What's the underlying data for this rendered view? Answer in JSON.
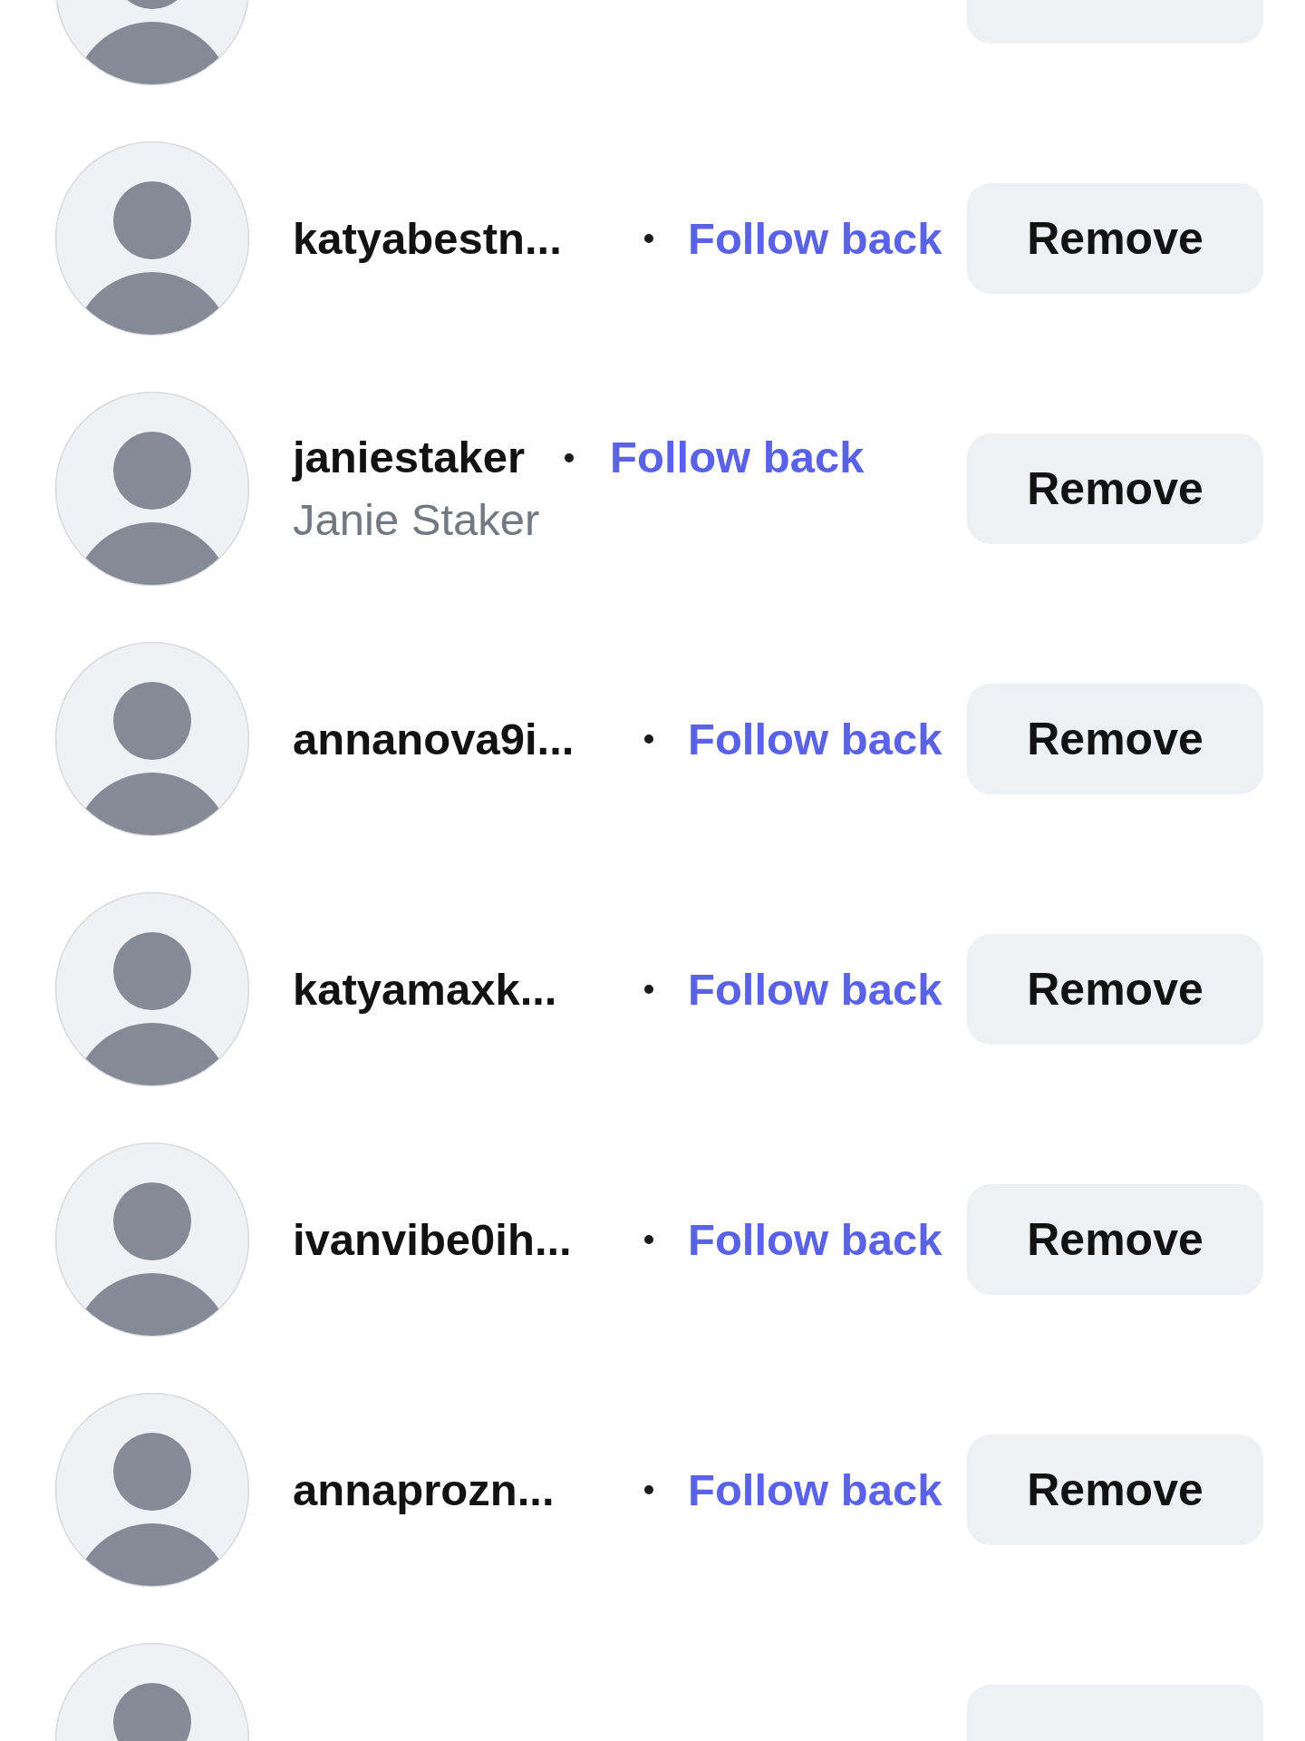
{
  "followers": [
    {
      "kind": "clipped"
    },
    {
      "kind": "row",
      "username": "katyabestn...",
      "follow_label": "Follow back",
      "remove_label": "Remove"
    },
    {
      "kind": "row",
      "username": "janiestaker",
      "full_name": "Janie Staker",
      "follow_label": "Follow back",
      "remove_label": "Remove"
    },
    {
      "kind": "row",
      "username": "annanova9i...",
      "follow_label": "Follow back",
      "remove_label": "Remove"
    },
    {
      "kind": "row",
      "username": "katyamaxk...",
      "follow_label": "Follow back",
      "remove_label": "Remove"
    },
    {
      "kind": "row",
      "username": "ivanvibe0ih...",
      "follow_label": "Follow back",
      "remove_label": "Remove"
    },
    {
      "kind": "row",
      "username": "annaprozn...",
      "follow_label": "Follow back",
      "remove_label": "Remove"
    },
    {
      "kind": "clipped"
    }
  ]
}
